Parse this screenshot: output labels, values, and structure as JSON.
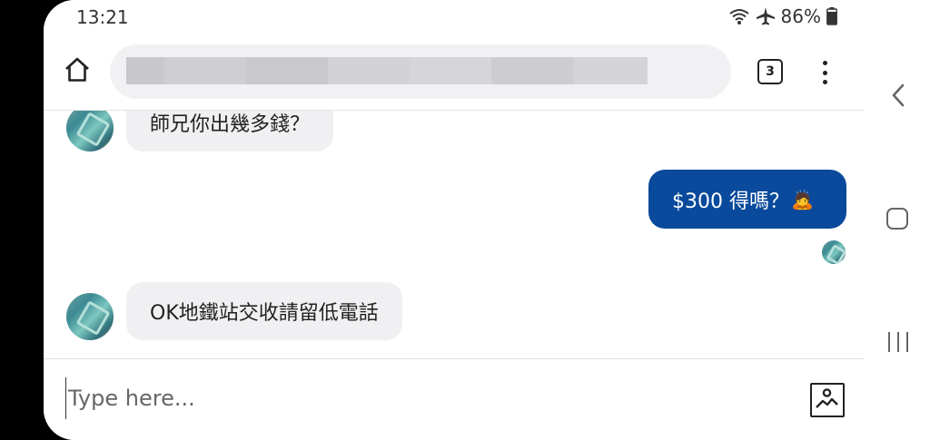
{
  "status_bar": {
    "time": "13:21",
    "battery": "86%"
  },
  "browser": {
    "tab_count": "3"
  },
  "chat": {
    "messages": [
      {
        "direction": "incoming",
        "text": "師兄你出幾多錢？"
      },
      {
        "direction": "outgoing",
        "text": "$300 得嗎？",
        "emoji": "🙇"
      },
      {
        "direction": "incoming",
        "text": "OK地鐵站交收請留低電話"
      }
    ]
  },
  "composer": {
    "placeholder": "Type here..."
  },
  "icons": {
    "home": "home-icon",
    "menu": "more-vert-icon",
    "image": "image-icon",
    "wifi": "wifi-icon",
    "airplane": "airplane-icon",
    "battery": "battery-icon"
  },
  "colors": {
    "outgoing_bubble": "#0a4a9c",
    "incoming_bubble": "#f0f0f2"
  }
}
